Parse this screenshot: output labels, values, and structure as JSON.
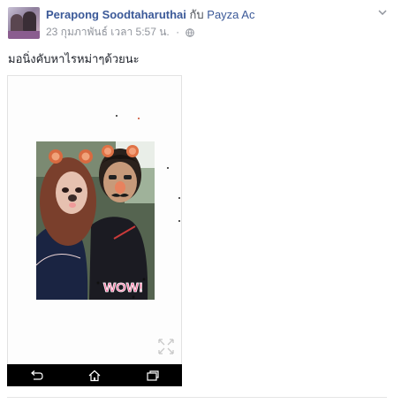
{
  "post": {
    "author_name": "Perapong Soodtaharuthai",
    "with_word": "กับ",
    "tagged_name": "Payza Ac",
    "timestamp": "23 กุมภาพันธ์ เวลา 5:57 น.",
    "separator": "·",
    "privacy_icon": "globe-icon",
    "menu_icon": "chevron-down-icon",
    "text": "มอนิ่งคับหาไรหม่าๆด้วยนะ"
  },
  "photo": {
    "sticker_text": "WOW!",
    "nav_icons": [
      "back-icon",
      "home-icon",
      "recent-apps-icon"
    ]
  },
  "colors": {
    "link": "#3b5998",
    "meta": "#90949c",
    "body_text": "#1d2129",
    "nav_bar": "#000000"
  }
}
